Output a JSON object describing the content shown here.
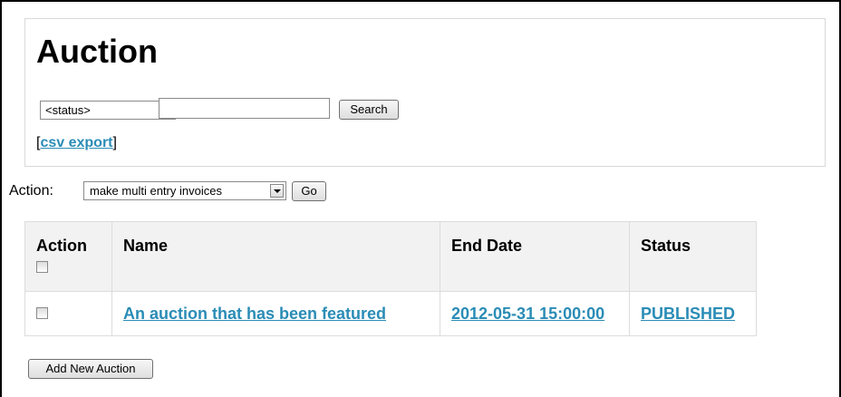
{
  "page": {
    "title": "Auction",
    "status_select": "<status>",
    "search_value": "",
    "search_label": "Search",
    "csv_bracket_open": "[",
    "csv_link": "csv export",
    "csv_bracket_close": "]"
  },
  "bulk": {
    "label": "Action:",
    "selected_option": "make multi entry invoices",
    "go_label": "Go"
  },
  "table": {
    "headers": {
      "action": "Action",
      "name": "Name",
      "end_date": "End Date",
      "status": "Status"
    },
    "rows": [
      {
        "checked": false,
        "name": "An auction that has been featured",
        "end_date": "2012-05-31 15:00:00",
        "status": "PUBLISHED"
      }
    ]
  },
  "footer": {
    "add_label": "Add New Auction"
  },
  "colors": {
    "link": "#2a8cb6",
    "header_bg": "#f2f2f2",
    "border": "#dcdcdc"
  },
  "icons": [
    "dropdown-arrow-icon",
    "checkbox"
  ]
}
